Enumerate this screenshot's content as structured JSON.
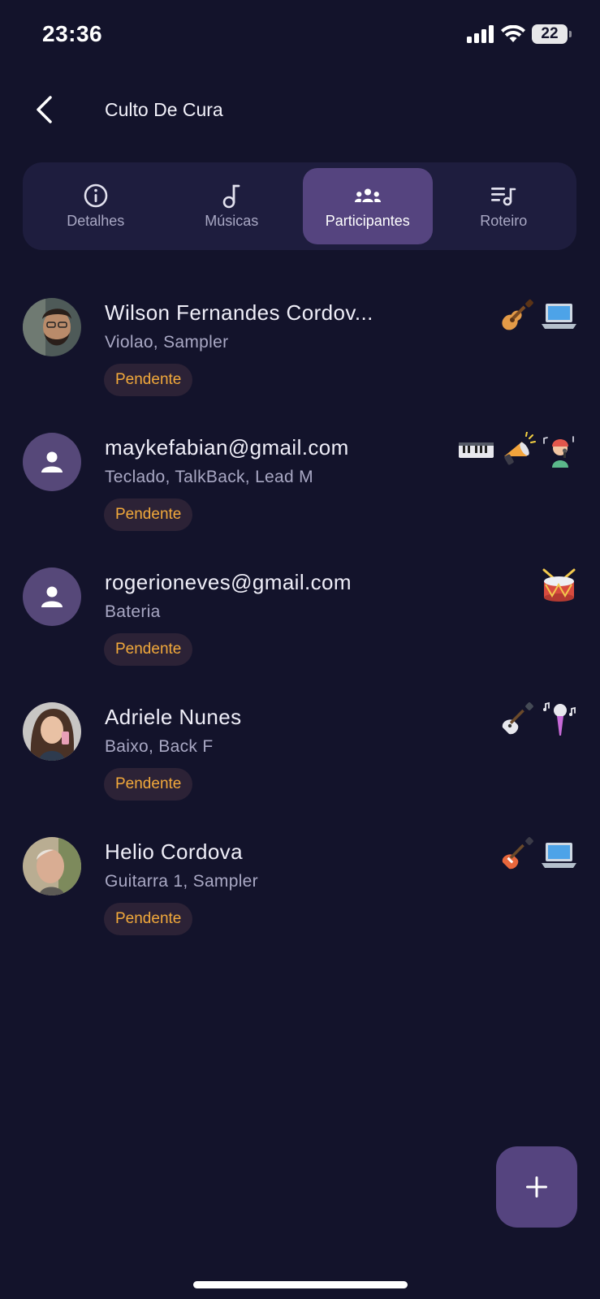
{
  "status_bar": {
    "time": "23:36",
    "battery_level": "22"
  },
  "header": {
    "title": "Culto De Cura"
  },
  "tabs": [
    {
      "label": "Detalhes",
      "icon": "info-icon",
      "active": false
    },
    {
      "label": "Músicas",
      "icon": "music-note-icon",
      "active": false
    },
    {
      "label": "Participantes",
      "icon": "group-icon",
      "active": true
    },
    {
      "label": "Roteiro",
      "icon": "playlist-icon",
      "active": false
    }
  ],
  "participants": [
    {
      "name": "Wilson Fernandes Cordov...",
      "roles": "Violao, Sampler",
      "status": "Pendente",
      "avatar": "photo",
      "instruments": [
        "acoustic-guitar-icon",
        "laptop-icon"
      ]
    },
    {
      "name": "maykefabian@gmail.com",
      "roles": "Teclado, TalkBack, Lead M",
      "status": "Pendente",
      "avatar": "placeholder",
      "instruments": [
        "keyboard-icon",
        "megaphone-icon",
        "singer-icon"
      ]
    },
    {
      "name": "rogerioneves@gmail.com",
      "roles": "Bateria",
      "status": "Pendente",
      "avatar": "placeholder",
      "instruments": [
        "drum-icon"
      ]
    },
    {
      "name": "Adriele Nunes",
      "roles": "Baixo, Back F",
      "status": "Pendente",
      "avatar": "photo",
      "instruments": [
        "bass-guitar-icon",
        "microphone-icon"
      ]
    },
    {
      "name": "Helio Cordova",
      "roles": "Guitarra 1, Sampler",
      "status": "Pendente",
      "avatar": "photo",
      "instruments": [
        "electric-guitar-icon",
        "laptop-icon"
      ]
    }
  ],
  "colors": {
    "background": "#13132b",
    "tab_active": "#55447f",
    "badge_text": "#f2a93b",
    "badge_bg": "#2c2236"
  }
}
